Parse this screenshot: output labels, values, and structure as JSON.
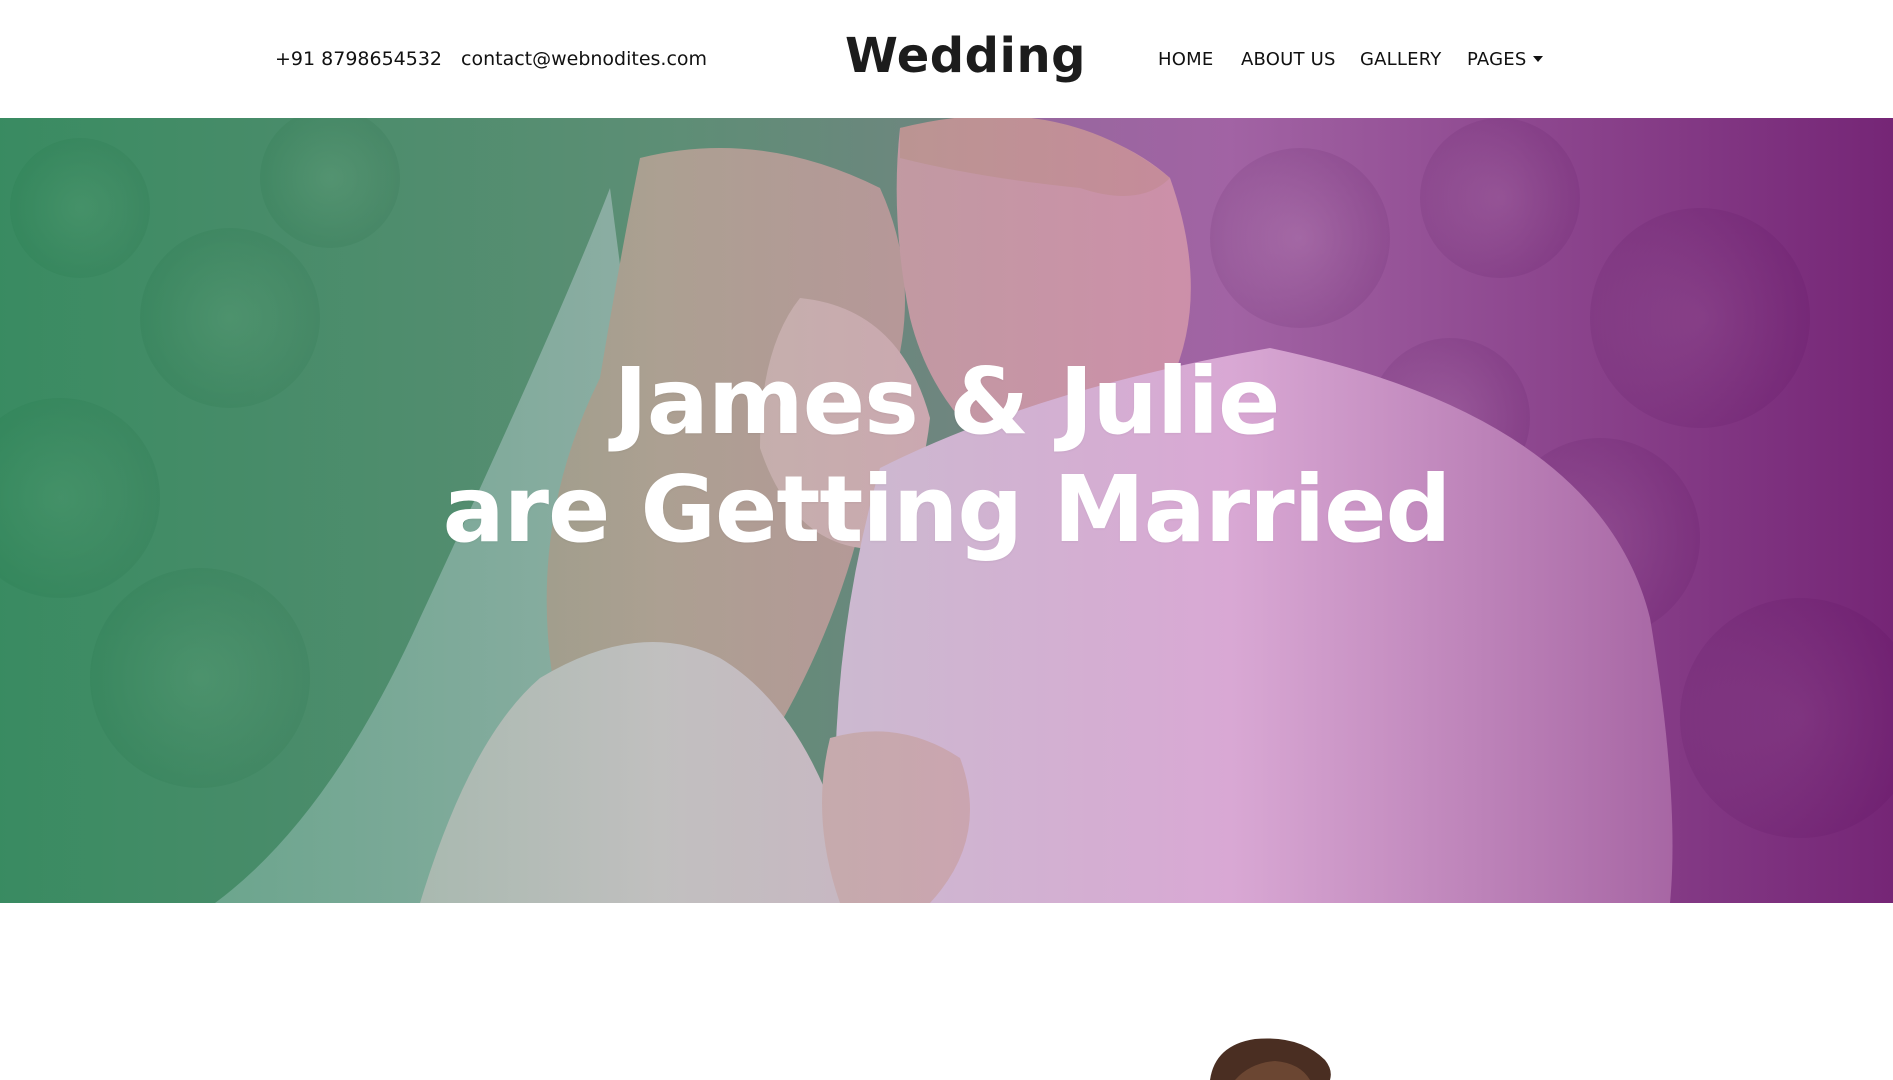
{
  "header": {
    "phone": "+91 8798654532",
    "email": "contact@webnodites.com",
    "brand": "Wedding",
    "nav": {
      "home": "HOME",
      "about": "ABOUT US",
      "gallery": "GALLERY",
      "pages": "PAGES"
    }
  },
  "hero": {
    "line1": "James & Julie",
    "line2": "are Getting Married"
  },
  "colors": {
    "overlay_left": "#2f8c64",
    "overlay_right": "#6e146e",
    "text_dark": "#1c1c1c"
  }
}
